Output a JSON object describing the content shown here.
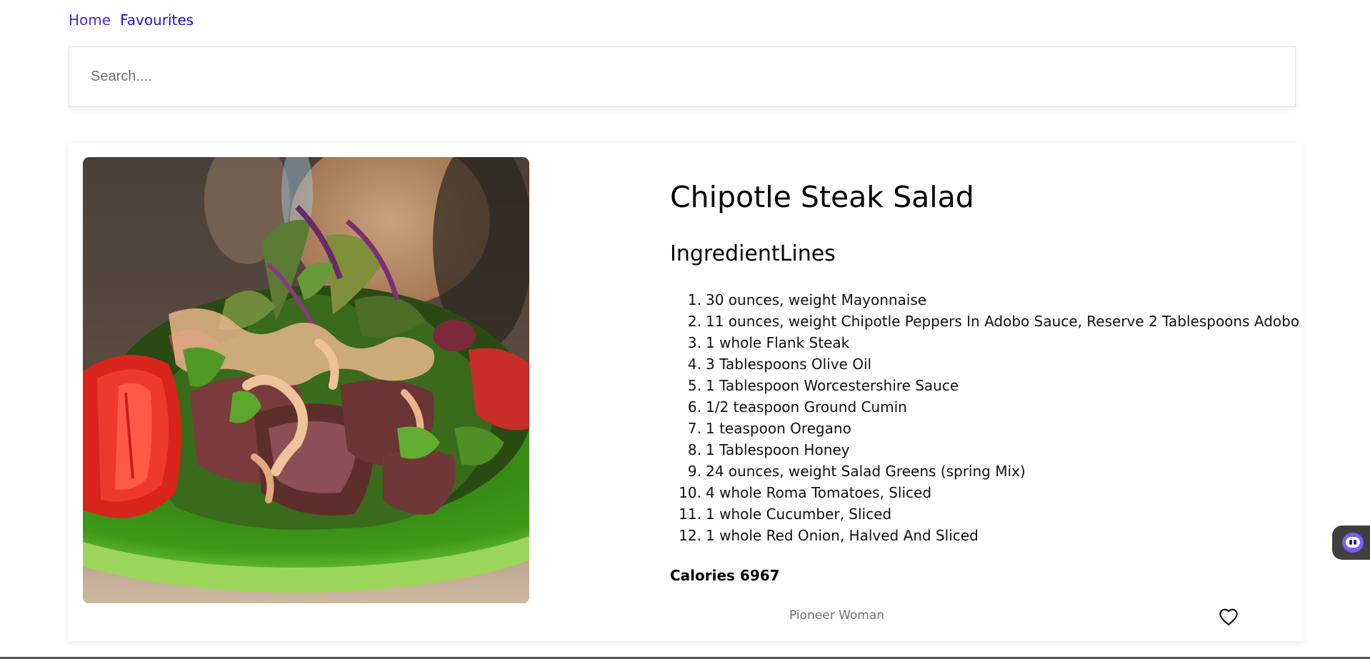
{
  "nav": {
    "home_label": "Home",
    "favourites_label": "Favourites"
  },
  "search": {
    "placeholder": "Search....",
    "value": ""
  },
  "recipe": {
    "title": "Chipotle Steak Salad",
    "ingredients_heading": "IngredientLines",
    "ingredients": [
      "30 ounces, weight Mayonnaise",
      "11 ounces, weight Chipotle Peppers In Adobo Sauce, Reserve 2 Tablespoons Adobo",
      "1 whole Flank Steak",
      "3 Tablespoons Olive Oil",
      "1 Tablespoon Worcestershire Sauce",
      "1/2 teaspoon Ground Cumin",
      "1 teaspoon Oregano",
      "1 Tablespoon Honey",
      "24 ounces, weight Salad Greens (spring Mix)",
      "4 whole Roma Tomatoes, Sliced",
      "1 whole Cucumber, Sliced",
      "1 whole Red Onion, Halved And Sliced"
    ],
    "calories_label": "Calories 6967",
    "source": "Pioneer Woman",
    "favourite_icon": "heart-outline-icon"
  },
  "widgets": {
    "assistant_icon": "chat-bot-icon"
  },
  "colors": {
    "home_link": "#4b2bd6",
    "favourites_link": "#1c14e0",
    "source_text": "#707070"
  }
}
